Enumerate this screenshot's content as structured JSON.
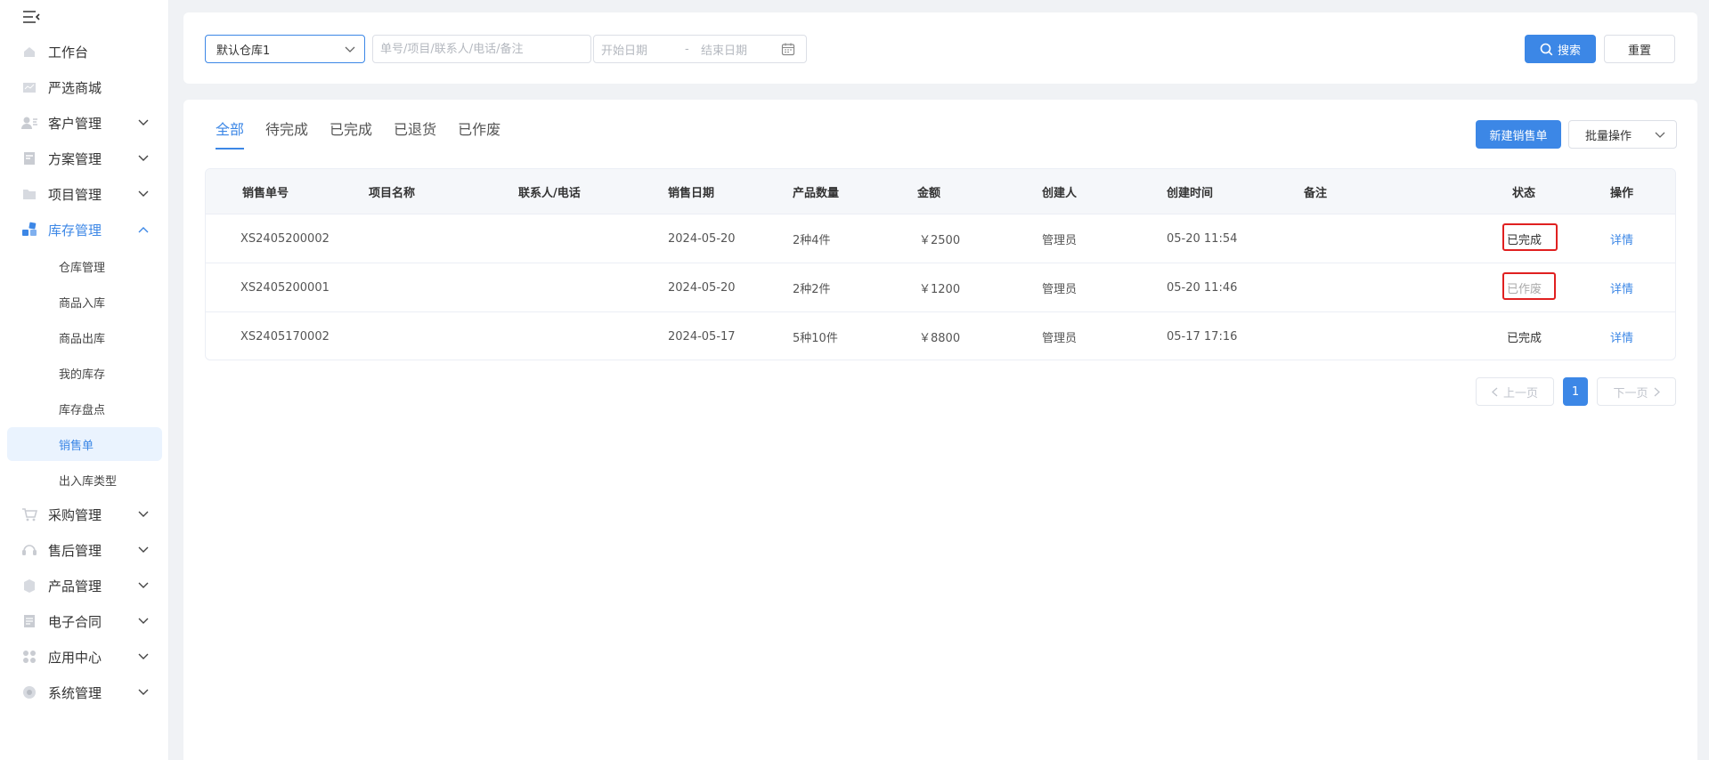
{
  "sidebar": {
    "items": [
      {
        "label": "工作台",
        "icon": "home-icon"
      },
      {
        "label": "严选商城",
        "icon": "mall-icon"
      },
      {
        "label": "客户管理",
        "icon": "customer-icon"
      },
      {
        "label": "方案管理",
        "icon": "plan-icon"
      },
      {
        "label": "项目管理",
        "icon": "folder-icon"
      },
      {
        "label": "库存管理",
        "icon": "inventory-icon"
      },
      {
        "label": "采购管理",
        "icon": "cart-icon"
      },
      {
        "label": "售后管理",
        "icon": "headset-icon"
      },
      {
        "label": "产品管理",
        "icon": "box-icon"
      },
      {
        "label": "电子合同",
        "icon": "contract-icon"
      },
      {
        "label": "应用中心",
        "icon": "apps-icon"
      },
      {
        "label": "系统管理",
        "icon": "settings-icon"
      }
    ],
    "sub_items": [
      "仓库管理",
      "商品入库",
      "商品出库",
      "我的库存",
      "库存盘点",
      "销售单",
      "出入库类型"
    ],
    "active_sub": "销售单"
  },
  "filter": {
    "warehouse": "默认仓库1",
    "search_placeholder": "单号/项目/联系人/电话/备注",
    "date_start": "开始日期",
    "date_sep": "-",
    "date_end": "结束日期",
    "search_label": "搜索",
    "reset_label": "重置"
  },
  "tabs": [
    "全部",
    "待完成",
    "已完成",
    "已退货",
    "已作废"
  ],
  "actions": {
    "new_label": "新建销售单",
    "batch_label": "批量操作"
  },
  "table": {
    "headers": [
      "销售单号",
      "项目名称",
      "联系人/电话",
      "销售日期",
      "产品数量",
      "金额",
      "创建人",
      "创建时间",
      "备注",
      "状态",
      "操作"
    ],
    "rows": [
      {
        "no": "XS2405200002",
        "project": "",
        "contact": "",
        "date": "2024-05-20",
        "qty": "2种4件",
        "amount": "￥2500",
        "creator": "管理员",
        "created": "05-20 11:54",
        "remark": "",
        "status": "已完成",
        "action": "详情"
      },
      {
        "no": "XS2405200001",
        "project": "",
        "contact": "",
        "date": "2024-05-20",
        "qty": "2种2件",
        "amount": "￥1200",
        "creator": "管理员",
        "created": "05-20 11:46",
        "remark": "",
        "status": "已作废",
        "action": "详情"
      },
      {
        "no": "XS2405170002",
        "project": "",
        "contact": "",
        "date": "2024-05-17",
        "qty": "5种10件",
        "amount": "￥8800",
        "creator": "管理员",
        "created": "05-17 17:16",
        "remark": "",
        "status": "已完成",
        "action": "详情"
      }
    ]
  },
  "pager": {
    "prev_label": "上一页",
    "current": "1",
    "next_label": "下一页"
  },
  "colors": {
    "accent": "#3c87e6",
    "highlight_box": "#e02020"
  }
}
